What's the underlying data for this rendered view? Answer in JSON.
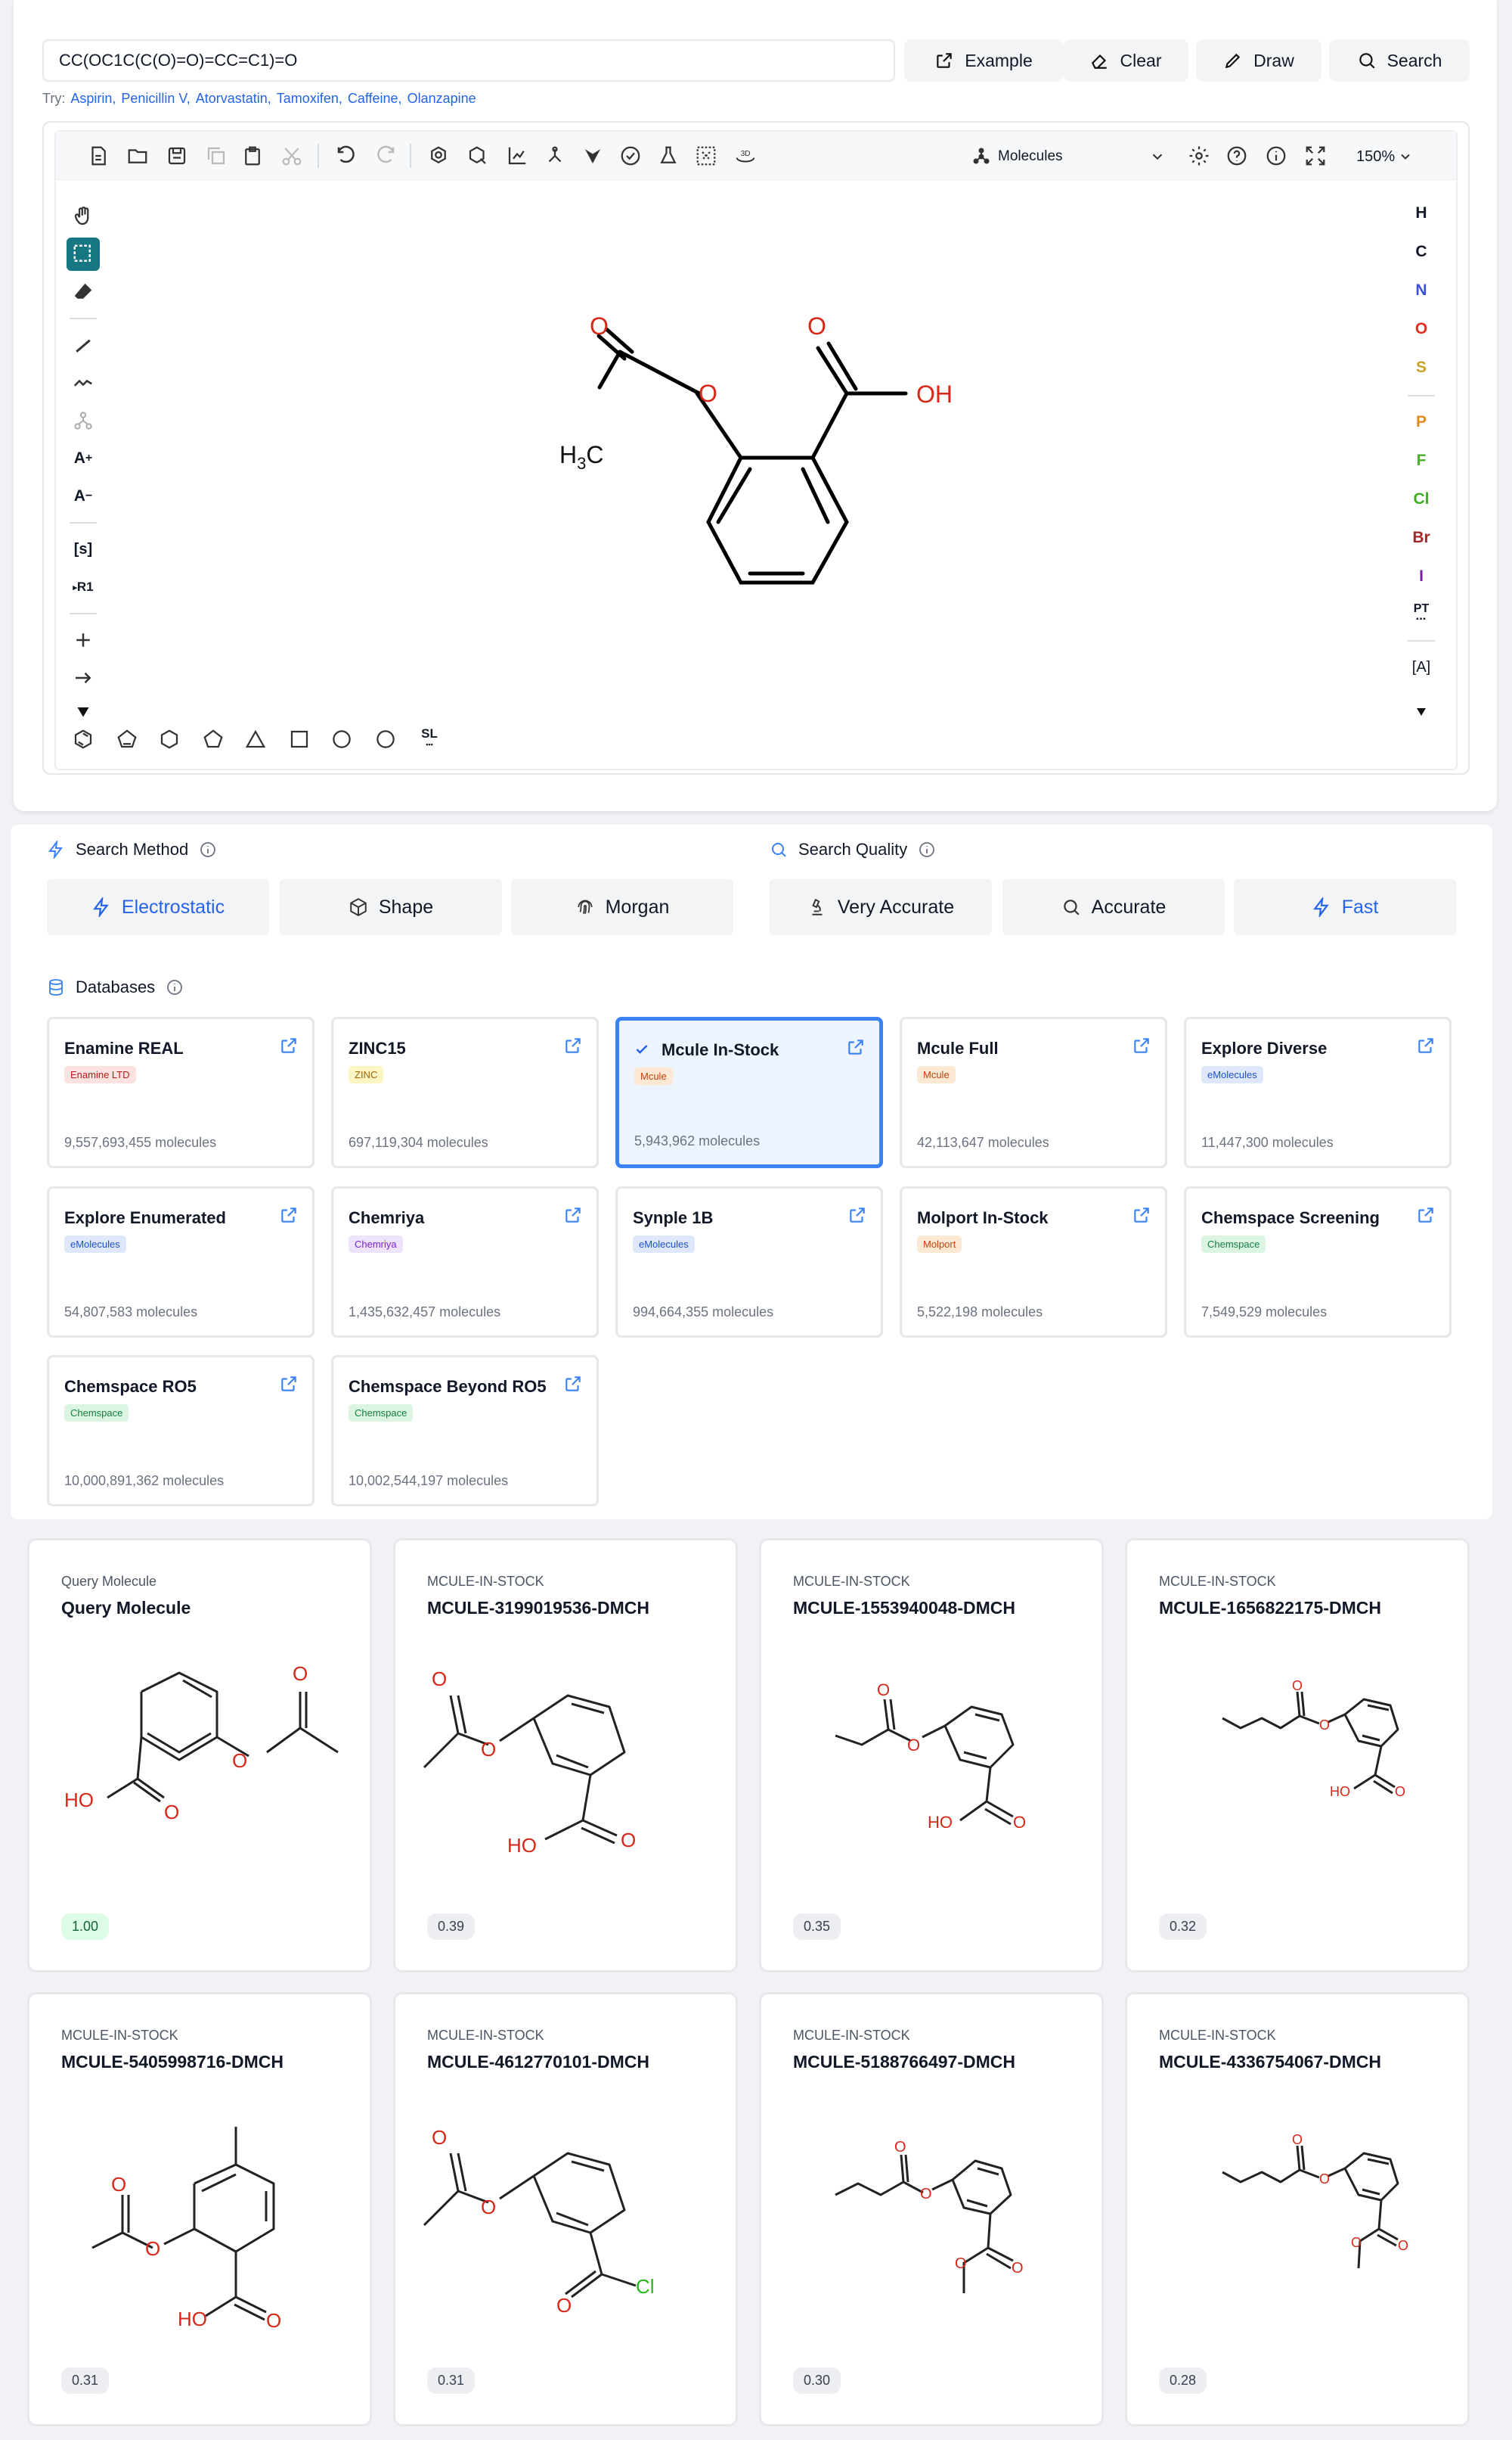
{
  "smiles_input": {
    "value": "CC(OC1C(C(O)=O)=CC=C1)=O"
  },
  "actions": [
    "Example",
    "Clear",
    "Draw",
    "Search"
  ],
  "try": {
    "prefix": "Try:",
    "items": [
      "Aspirin,",
      "Penicillin V,",
      "Atorvastatin,",
      "Tamoxifen,",
      "Caffeine,",
      "Olanzapine"
    ]
  },
  "editor": {
    "mode": "Molecules",
    "zoom": "150%",
    "left_tools": {
      "charge_plus": "A",
      "charge_minus": "A",
      "sgroup": "[s]",
      "rgroup": "R1"
    },
    "elements": [
      {
        "s": "H",
        "c": "#111827"
      },
      {
        "s": "C",
        "c": "#111827"
      },
      {
        "s": "N",
        "c": "#3b4fd6"
      },
      {
        "s": "O",
        "c": "#e02d22"
      },
      {
        "s": "S",
        "c": "#c9a227"
      },
      {
        "s": "P",
        "c": "#e08a1e"
      },
      {
        "s": "F",
        "c": "#4cae2a"
      },
      {
        "s": "Cl",
        "c": "#3fae24"
      },
      {
        "s": "Br",
        "c": "#a02a2a"
      },
      {
        "s": "I",
        "c": "#7a1fa2"
      }
    ],
    "pt": "PT",
    "ext": "[A]",
    "sl": "SL",
    "molecule": {
      "o1": "O",
      "o2": "O",
      "o3": "O",
      "oh": "OH",
      "h3c": "H",
      "h3c_sub": "3",
      "h3c_c": "C"
    }
  },
  "search_method": {
    "label": "Search Method",
    "options": [
      "Electrostatic",
      "Shape",
      "Morgan"
    ],
    "selected": "Electrostatic"
  },
  "search_quality": {
    "label": "Search Quality",
    "options": [
      "Very Accurate",
      "Accurate",
      "Fast"
    ],
    "selected": "Fast"
  },
  "databases": {
    "label": "Databases",
    "items": [
      {
        "name": "Enamine REAL",
        "tag": "Enamine LTD",
        "count": "9,557,693,455 molecules",
        "tag_bg": "#fde2e2",
        "tag_fg": "#b91c1c"
      },
      {
        "name": "ZINC15",
        "tag": "ZINC",
        "count": "697,119,304 molecules",
        "tag_bg": "#fdf6c3",
        "tag_fg": "#a16207"
      },
      {
        "name": "Mcule In-Stock",
        "tag": "Mcule",
        "count": "5,943,962 molecules",
        "tag_bg": "#fde8d4",
        "tag_fg": "#c2410c"
      },
      {
        "name": "Mcule Full",
        "tag": "Mcule",
        "count": "42,113,647 molecules",
        "tag_bg": "#fde8d4",
        "tag_fg": "#c2410c"
      },
      {
        "name": "Explore Diverse",
        "tag": "eMolecules",
        "count": "11,447,300 molecules",
        "tag_bg": "#dfe7fb",
        "tag_fg": "#1d4ed8"
      },
      {
        "name": "Explore Enumerated",
        "tag": "eMolecules",
        "count": "54,807,583 molecules",
        "tag_bg": "#dfe7fb",
        "tag_fg": "#1d4ed8"
      },
      {
        "name": "Chemriya",
        "tag": "Chemriya",
        "count": "1,435,632,457 molecules",
        "tag_bg": "#ede4fb",
        "tag_fg": "#7e22ce"
      },
      {
        "name": "Synple 1B",
        "tag": "eMolecules",
        "count": "994,664,355 molecules",
        "tag_bg": "#dfe7fb",
        "tag_fg": "#1d4ed8"
      },
      {
        "name": "Molport In-Stock",
        "tag": "Molport",
        "count": "5,522,198 molecules",
        "tag_bg": "#fde8d4",
        "tag_fg": "#c2410c"
      },
      {
        "name": "Chemspace Screening",
        "tag": "Chemspace",
        "count": "7,549,529 molecules",
        "tag_bg": "#dcf5e3",
        "tag_fg": "#15803d"
      },
      {
        "name": "Chemspace RO5",
        "tag": "Chemspace",
        "count": "10,000,891,362 molecules",
        "tag_bg": "#dcf5e3",
        "tag_fg": "#15803d"
      },
      {
        "name": "Chemspace Beyond RO5",
        "tag": "Chemspace",
        "count": "10,002,544,197 molecules",
        "tag_bg": "#dcf5e3",
        "tag_fg": "#15803d"
      }
    ],
    "selected": "Mcule In-Stock"
  },
  "results": [
    {
      "source": "Query Molecule",
      "name": "Query Molecule",
      "score": "1.00"
    },
    {
      "source": "MCULE-IN-STOCK",
      "name": "MCULE-3199019536-DMCH",
      "score": "0.39"
    },
    {
      "source": "MCULE-IN-STOCK",
      "name": "MCULE-1553940048-DMCH",
      "score": "0.35"
    },
    {
      "source": "MCULE-IN-STOCK",
      "name": "MCULE-1656822175-DMCH",
      "score": "0.32"
    },
    {
      "source": "MCULE-IN-STOCK",
      "name": "MCULE-5405998716-DMCH",
      "score": "0.31"
    },
    {
      "source": "MCULE-IN-STOCK",
      "name": "MCULE-4612770101-DMCH",
      "score": "0.31"
    },
    {
      "source": "MCULE-IN-STOCK",
      "name": "MCULE-5188766497-DMCH",
      "score": "0.30"
    },
    {
      "source": "MCULE-IN-STOCK",
      "name": "MCULE-4336754067-DMCH",
      "score": "0.28"
    }
  ],
  "mol_labels": {
    "o": "O",
    "ho": "HO",
    "cl": "Cl"
  }
}
